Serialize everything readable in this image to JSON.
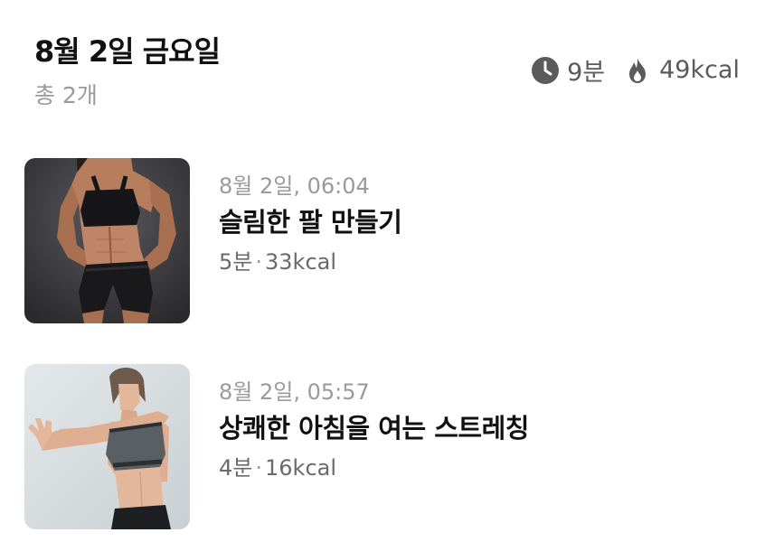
{
  "header": {
    "date_title": "8월 2일 금요일",
    "total_count": "총 2개",
    "total_duration": "9분",
    "total_calories": "49kcal",
    "duration_icon": "clock-icon",
    "calories_icon": "flame-icon"
  },
  "workouts": [
    {
      "time": "8월 2일, 06:04",
      "title": "슬림한 팔 만들기",
      "duration": "5분",
      "calories": "33kcal",
      "separator": "·"
    },
    {
      "time": "8월 2일, 05:57",
      "title": "상쾌한 아침을 여는 스트레칭",
      "duration": "4분",
      "calories": "16kcal",
      "separator": "·"
    }
  ],
  "colors": {
    "title": "#111111",
    "muted": "#9a9a9a",
    "meta": "#6a6a6a",
    "icon": "#5b5b5b"
  }
}
